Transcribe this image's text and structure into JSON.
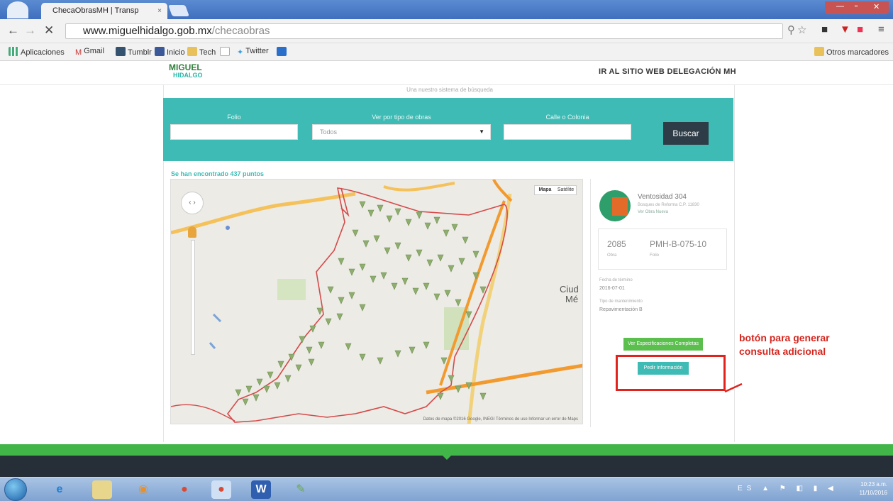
{
  "browser": {
    "tab_title": "ChecaObrasMH | Transp",
    "tab_close": "×",
    "url_domain": "www.miguelhidalgo.gob.mx",
    "url_path": "/checaobras",
    "bookmarks": [
      "Aplicaciones",
      "Gmail",
      "Tumblr",
      "Inicio",
      "Tech",
      "Twitter"
    ],
    "other_bookmarks": "Otros marcadores"
  },
  "header": {
    "logo_line1": "MIGUEL",
    "logo_line2": "HIDALGO",
    "site_link": "IR AL SITIO WEB DELEGACIÓN MH"
  },
  "intro_text": "Una nuestro sistema de búsqueda",
  "search": {
    "label_folio": "Folio",
    "label_tipo": "Ver por tipo de obras",
    "label_calle": "Calle o Colonia",
    "select_value": "Todos",
    "button": "Buscar"
  },
  "results": {
    "found_text": "Se han encontrado 437 puntos"
  },
  "map": {
    "type_map": "Mapa",
    "type_sat": "Satélite",
    "city_label_1": "Ciud",
    "city_label_2": "Mé",
    "attribution": "Datos de mapa ©2016 Google, INEGI   Términos de uso   Informar un error de Maps"
  },
  "panel": {
    "name": "Ventosidad 304",
    "address": "Bosques de Reforma C.P. 11830",
    "tag": "Ver Obra Nueva",
    "stat1_value": "2085",
    "stat1_label": "Obra",
    "stat2_value": "PMH-B-075-10",
    "stat2_label": "Folio",
    "date_label": "Fecha de término",
    "date_value": "2016-07-01",
    "type_label": "Tipo de mantenimiento",
    "type_value": "Repavimentación B",
    "btn_green": "Ver Especificaciones Completas",
    "btn_teal": "Pedir Información"
  },
  "annotation": {
    "line1": "botón para generar",
    "line2": "consulta adicional",
    "color": "#e0231d"
  },
  "taskbar": {
    "time": "10:23 a.m.",
    "date": "11/10/2016",
    "lang": "ES"
  }
}
